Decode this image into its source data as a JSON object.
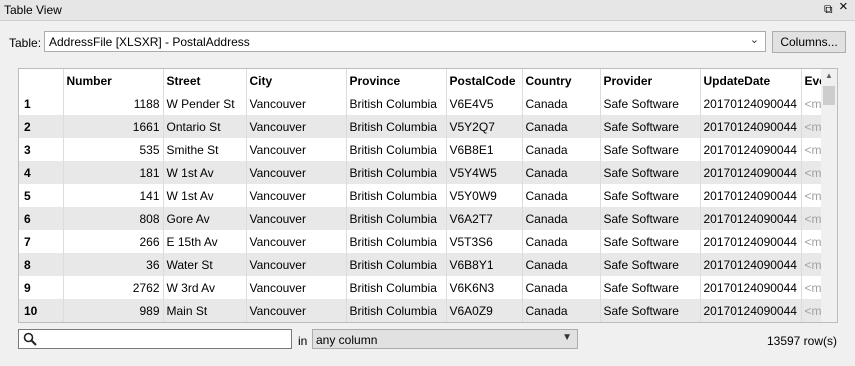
{
  "window": {
    "title": "Table View",
    "float_glyph": "⧉",
    "close_glyph": "×"
  },
  "toolbar": {
    "table_label": "Table:",
    "table_value": "AddressFile [XLSXR] - PostalAddress",
    "columns_button": "Columns..."
  },
  "grid": {
    "headers": [
      "Number",
      "Street",
      "City",
      "Province",
      "PostalCode",
      "Country",
      "Provider",
      "UpdateDate",
      "Eve"
    ],
    "rows": [
      {
        "n": "1",
        "cells": [
          "1188",
          "W Pender St",
          "Vancouver",
          "British Columbia",
          "V6E4V5",
          "Canada",
          "Safe Software",
          "20170124090044",
          "<m"
        ]
      },
      {
        "n": "2",
        "cells": [
          "1661",
          "Ontario St",
          "Vancouver",
          "British Columbia",
          "V5Y2Q7",
          "Canada",
          "Safe Software",
          "20170124090044",
          "<m"
        ]
      },
      {
        "n": "3",
        "cells": [
          "535",
          "Smithe St",
          "Vancouver",
          "British Columbia",
          "V6B8E1",
          "Canada",
          "Safe Software",
          "20170124090044",
          "<m"
        ]
      },
      {
        "n": "4",
        "cells": [
          "181",
          "W 1st Av",
          "Vancouver",
          "British Columbia",
          "V5Y4W5",
          "Canada",
          "Safe Software",
          "20170124090044",
          "<m"
        ]
      },
      {
        "n": "5",
        "cells": [
          "141",
          "W 1st Av",
          "Vancouver",
          "British Columbia",
          "V5Y0W9",
          "Canada",
          "Safe Software",
          "20170124090044",
          "<m"
        ]
      },
      {
        "n": "6",
        "cells": [
          "808",
          "Gore Av",
          "Vancouver",
          "British Columbia",
          "V6A2T7",
          "Canada",
          "Safe Software",
          "20170124090044",
          "<m"
        ]
      },
      {
        "n": "7",
        "cells": [
          "266",
          "E 15th Av",
          "Vancouver",
          "British Columbia",
          "V5T3S6",
          "Canada",
          "Safe Software",
          "20170124090044",
          "<m"
        ]
      },
      {
        "n": "8",
        "cells": [
          "36",
          "Water St",
          "Vancouver",
          "British Columbia",
          "V6B8Y1",
          "Canada",
          "Safe Software",
          "20170124090044",
          "<m"
        ]
      },
      {
        "n": "9",
        "cells": [
          "2762",
          "W 3rd Av",
          "Vancouver",
          "British Columbia",
          "V6K6N3",
          "Canada",
          "Safe Software",
          "20170124090044",
          "<m"
        ]
      },
      {
        "n": "10",
        "cells": [
          "989",
          "Main St",
          "Vancouver",
          "British Columbia",
          "V6A0Z9",
          "Canada",
          "Safe Software",
          "20170124090044",
          "<m"
        ]
      }
    ]
  },
  "footer": {
    "search_placeholder": "",
    "in_label": "in",
    "column_filter": "any column",
    "row_count": "13597 row(s)"
  },
  "icons": {
    "search": "search-icon",
    "dropdown": "chevron-down-icon",
    "scroll_up": "scroll-up-arrow-icon"
  }
}
